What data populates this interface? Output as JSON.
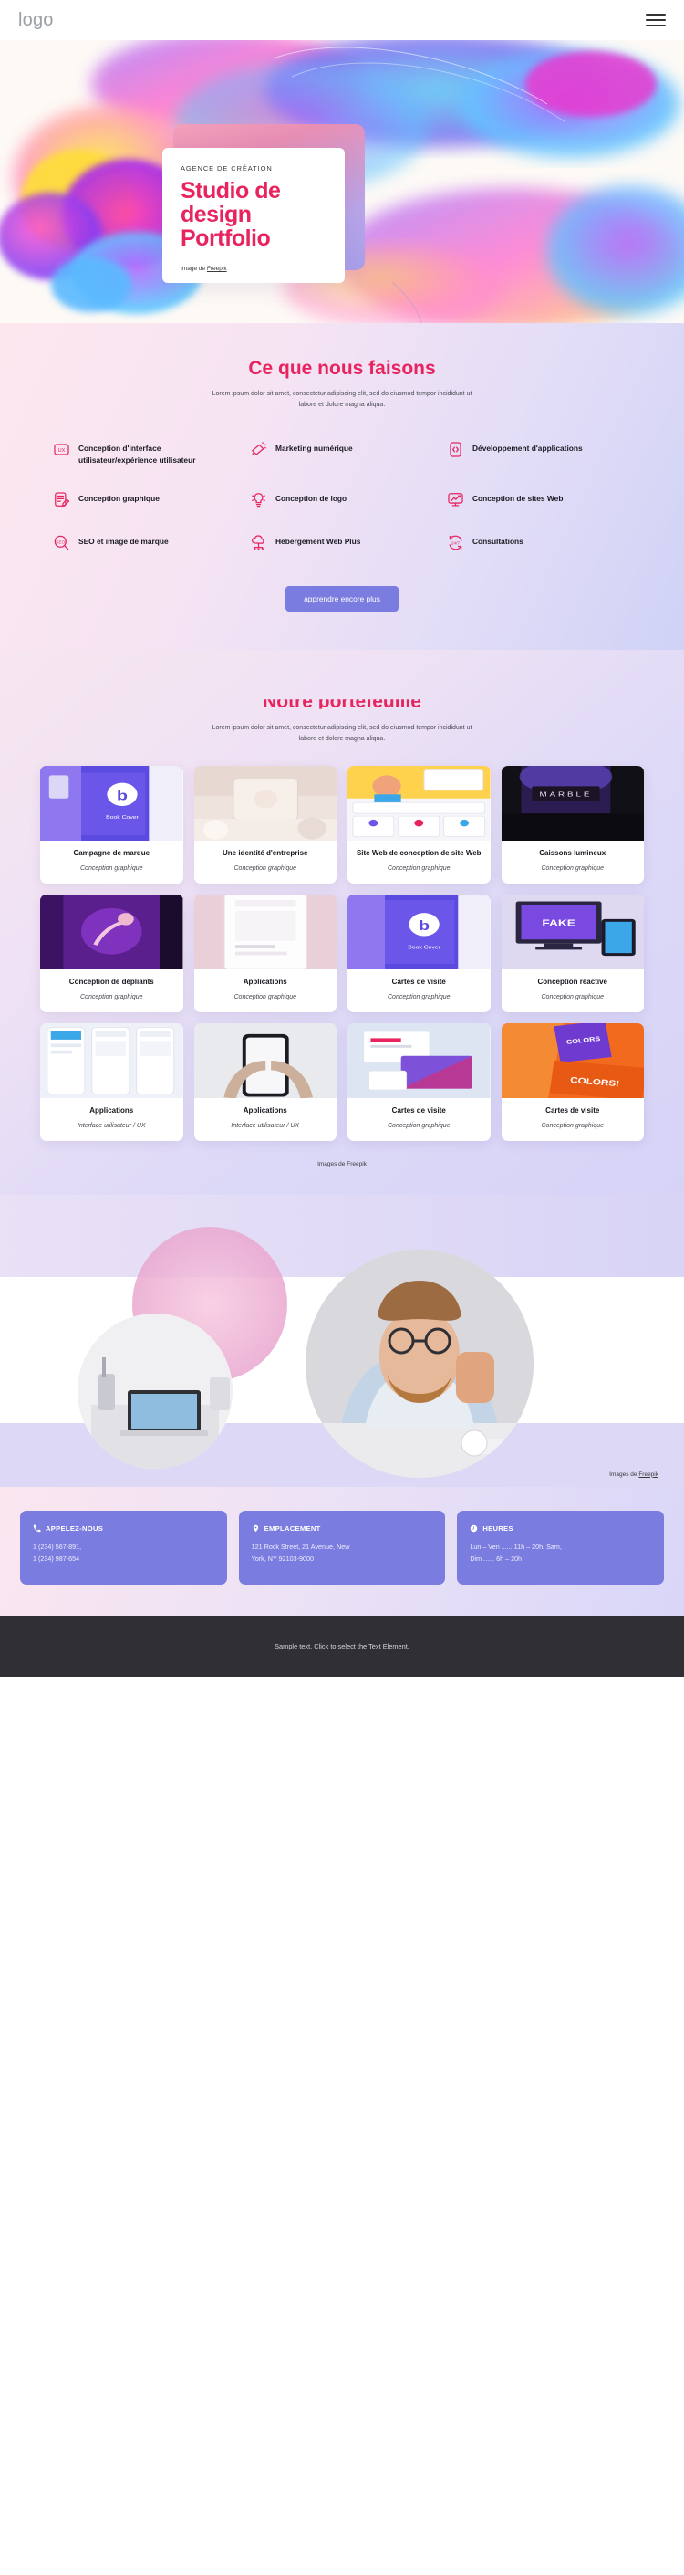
{
  "header": {
    "logo": "logo",
    "menu_icon": "hamburger-menu-icon"
  },
  "hero": {
    "eyebrow": "AGENCE DE CRÉATION",
    "title_line1": "Studio de",
    "title_line2": "design",
    "title_line3": "Portfolio",
    "credit_prefix": "Image de ",
    "credit_link": "Freepik"
  },
  "services": {
    "title": "Ce que nous faisons",
    "subtitle": "Lorem ipsum dolor sit amet, consectetur adipiscing elit, sed do eiusmod tempor incididunt ut labore et dolore magna aliqua.",
    "items": [
      {
        "label": "Conception d'interface utilisateur/expérience utilisateur",
        "icon": "ux-badge-icon"
      },
      {
        "label": "Marketing numérique",
        "icon": "megaphone-icon"
      },
      {
        "label": "Développement d'applications",
        "icon": "mobile-code-icon"
      },
      {
        "label": "Conception graphique",
        "icon": "document-pen-icon"
      },
      {
        "label": "Conception de logo",
        "icon": "lightbulb-icon"
      },
      {
        "label": "Conception de sites Web",
        "icon": "monitor-chart-icon"
      },
      {
        "label": "SEO et image de marque",
        "icon": "seo-magnifier-icon"
      },
      {
        "label": "Hébergement Web Plus",
        "icon": "cloud-hosting-icon"
      },
      {
        "label": "Consultations",
        "icon": "24-7-support-icon"
      }
    ],
    "cta_label": "apprendre encore plus",
    "accent_color": "#e8245f",
    "button_color": "#7b7ce0"
  },
  "portfolio": {
    "title": "Notre portefeuille",
    "subtitle": "Lorem ipsum dolor sit amet, consectetur adipiscing elit, sed do eiusmod tempor incididunt ut labore et dolore magna aliqua.",
    "items": [
      {
        "title": "Campagne de marque",
        "category": "Conception graphique"
      },
      {
        "title": "Une identité d'entreprise",
        "category": "Conception graphique"
      },
      {
        "title": "Site Web de conception de site Web",
        "category": "Conception graphique"
      },
      {
        "title": "Caissons lumineux",
        "category": "Conception graphique"
      },
      {
        "title": "Conception de dépliants",
        "category": "Conception graphique"
      },
      {
        "title": "Applications",
        "category": "Conception graphique"
      },
      {
        "title": "Cartes de visite",
        "category": "Conception graphique"
      },
      {
        "title": "Conception réactive",
        "category": "Conception graphique"
      },
      {
        "title": "Applications",
        "category": "Interface utilisateur / UX"
      },
      {
        "title": "Applications",
        "category": "Interface utilisateur / UX"
      },
      {
        "title": "Cartes de visite",
        "category": "Conception graphique"
      },
      {
        "title": "Cartes de visite",
        "category": "Conception graphique"
      }
    ],
    "credit_prefix": "Images de ",
    "credit_link": "Freepik"
  },
  "band": {
    "credit_prefix": "Images de ",
    "credit_link": "Freepik"
  },
  "contact": {
    "cards": [
      {
        "icon": "phone-icon",
        "heading": "APPELEZ-NOUS",
        "line1": "1 (234) 567-891,",
        "line2": "1 (234) 987-654"
      },
      {
        "icon": "map-pin-icon",
        "heading": "EMPLACEMENT",
        "line1": "121 Rock Street, 21 Avenue, New",
        "line2": "York, NY 92103-9000"
      },
      {
        "icon": "clock-icon",
        "heading": "HEURES",
        "line1": "Lun – Ven ...... 11h – 20h, Sam,",
        "line2": "Dim  ...... 6h – 20h"
      }
    ]
  },
  "footer": {
    "text": "Sample text. Click to select the Text Element."
  }
}
